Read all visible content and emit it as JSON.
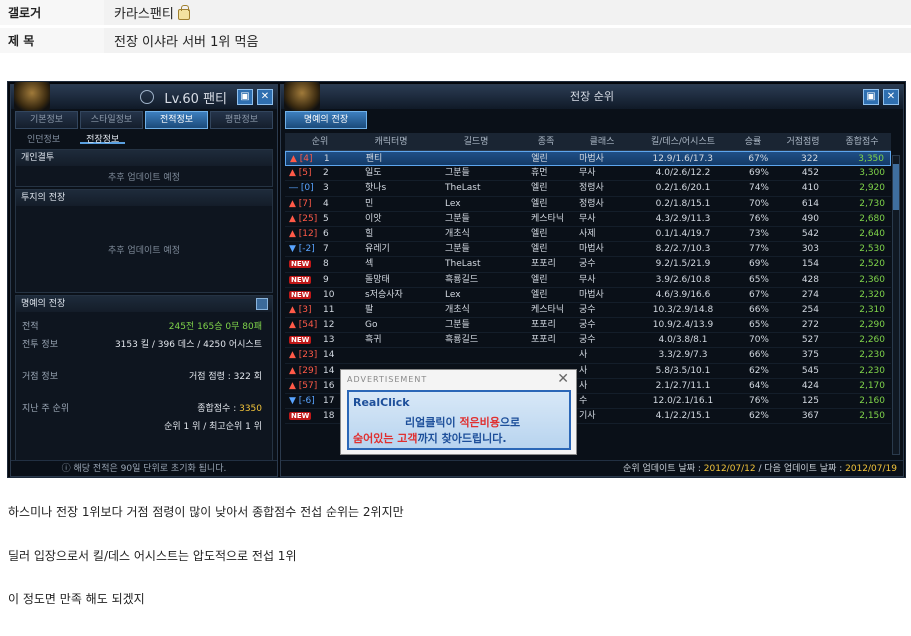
{
  "post": {
    "gallery_label": "갤로거",
    "gallery_value": "카라스팬티",
    "title_label": "제 목",
    "title_value": "전장 이샤라 서버 1위 먹음"
  },
  "left_panel": {
    "level": "Lv.60 팬티",
    "tabs": [
      "기본정보",
      "스타일정보",
      "전적정보",
      "평판정보"
    ],
    "active_tab": 2,
    "subtabs": [
      "인던정보",
      "전장정보"
    ],
    "active_subtab": 1,
    "sec1_title": "개인결투",
    "sec1_body": "추후 업데이트 예정",
    "sec2_title": "투지의 전장",
    "sec2_body": "추후 업데이트 예정",
    "sec3_title": "명예의 전장",
    "stats": [
      {
        "label": "전적",
        "value": "245전 165승 0무 80패"
      },
      {
        "label": "전투 정보",
        "value": "3153 킬 / 396 데스 / 4250 어시스트"
      },
      {
        "label": "거점 정보",
        "value": "거점 점령 : 322 회"
      },
      {
        "label": "지난 주 순위",
        "value_prefix": "종합점수 : ",
        "value_highlight": "3350"
      },
      {
        "label": "",
        "value": "순위 1 위 / 최고순위 1 위"
      }
    ],
    "footer": "해당 전적은 90일 단위로 초기화 됩니다."
  },
  "right_panel": {
    "title": "전장 순위",
    "tab": "명예의 전장",
    "headers": [
      "순위",
      "캐릭터명",
      "길드명",
      "종족",
      "클래스",
      "킬/데스/어시스트",
      "승률",
      "거점점령",
      "종합점수"
    ],
    "rows": [
      {
        "change": "▲ [4]",
        "dir": "up",
        "rank": "1",
        "name": "팬티",
        "guild": "",
        "race": "엘린",
        "cls": "마법사",
        "kda": "12.9/1.6/17.3",
        "win": "67%",
        "base": "322",
        "score": "3,350"
      },
      {
        "change": "▲ [5]",
        "dir": "up",
        "rank": "2",
        "name": "일도",
        "guild": "그분들",
        "race": "휴먼",
        "cls": "무사",
        "kda": "4.0/2.6/12.2",
        "win": "69%",
        "base": "452",
        "score": "3,300"
      },
      {
        "change": "― [0]",
        "dir": "same",
        "rank": "3",
        "name": "핫나s",
        "guild": "TheLast",
        "race": "엘린",
        "cls": "정령사",
        "kda": "0.2/1.6/20.1",
        "win": "74%",
        "base": "410",
        "score": "2,920"
      },
      {
        "change": "▲ [7]",
        "dir": "up",
        "rank": "4",
        "name": "민",
        "guild": "Lex",
        "race": "엘린",
        "cls": "정령사",
        "kda": "0.2/1.8/15.1",
        "win": "70%",
        "base": "614",
        "score": "2,730"
      },
      {
        "change": "▲ [25]",
        "dir": "up",
        "rank": "5",
        "name": "이앗",
        "guild": "그분들",
        "race": "케스타닉",
        "cls": "무사",
        "kda": "4.3/2.9/11.3",
        "win": "76%",
        "base": "490",
        "score": "2,680"
      },
      {
        "change": "▲ [12]",
        "dir": "up",
        "rank": "6",
        "name": "힐",
        "guild": "개초식",
        "race": "엘린",
        "cls": "사제",
        "kda": "0.1/1.4/19.7",
        "win": "73%",
        "base": "542",
        "score": "2,640"
      },
      {
        "change": "▼ [-2]",
        "dir": "dn",
        "rank": "7",
        "name": "유레기",
        "guild": "그분들",
        "race": "엘린",
        "cls": "마법사",
        "kda": "8.2/2.7/10.3",
        "win": "77%",
        "base": "303",
        "score": "2,530"
      },
      {
        "change": "NEW",
        "dir": "new",
        "rank": "8",
        "name": "섹",
        "guild": "TheLast",
        "race": "포포리",
        "cls": "궁수",
        "kda": "9.2/1.5/21.9",
        "win": "69%",
        "base": "154",
        "score": "2,520"
      },
      {
        "change": "NEW",
        "dir": "new",
        "rank": "9",
        "name": "돌망태",
        "guild": "흑룡길드",
        "race": "엘린",
        "cls": "무사",
        "kda": "3.9/2.6/10.8",
        "win": "65%",
        "base": "428",
        "score": "2,360"
      },
      {
        "change": "NEW",
        "dir": "new",
        "rank": "10",
        "name": "s저승사자",
        "guild": "Lex",
        "race": "엘린",
        "cls": "마법사",
        "kda": "4.6/3.9/16.6",
        "win": "67%",
        "base": "274",
        "score": "2,320"
      },
      {
        "change": "▲ [3]",
        "dir": "up",
        "rank": "11",
        "name": "팔",
        "guild": "개초식",
        "race": "케스타닉",
        "cls": "궁수",
        "kda": "10.3/2.9/14.8",
        "win": "66%",
        "base": "254",
        "score": "2,310"
      },
      {
        "change": "▲ [54]",
        "dir": "up",
        "rank": "12",
        "name": "Go",
        "guild": "그분들",
        "race": "포포리",
        "cls": "궁수",
        "kda": "10.9/2.4/13.9",
        "win": "65%",
        "base": "272",
        "score": "2,290"
      },
      {
        "change": "NEW",
        "dir": "new",
        "rank": "13",
        "name": "흑귀",
        "guild": "흑룡길드",
        "race": "포포리",
        "cls": "궁수",
        "kda": "4.0/3.8/8.1",
        "win": "70%",
        "base": "527",
        "score": "2,260"
      },
      {
        "change": "▲ [23]",
        "dir": "up",
        "rank": "14",
        "name": "",
        "guild": "",
        "race": "",
        "cls": "사",
        "kda": "3.3/2.9/7.3",
        "win": "66%",
        "base": "375",
        "score": "2,230"
      },
      {
        "change": "▲ [29]",
        "dir": "up",
        "rank": "14",
        "name": "",
        "guild": "",
        "race": "",
        "cls": "사",
        "kda": "5.8/3.5/10.1",
        "win": "62%",
        "base": "545",
        "score": "2,230"
      },
      {
        "change": "▲ [57]",
        "dir": "up",
        "rank": "16",
        "name": "",
        "guild": "",
        "race": "",
        "cls": "사",
        "kda": "2.1/2.7/11.1",
        "win": "64%",
        "base": "424",
        "score": "2,170"
      },
      {
        "change": "▼ [-6]",
        "dir": "dn",
        "rank": "17",
        "name": "",
        "guild": "",
        "race": "",
        "cls": "수",
        "kda": "12.0/2.1/16.1",
        "win": "76%",
        "base": "125",
        "score": "2,160"
      },
      {
        "change": "NEW",
        "dir": "new",
        "rank": "18",
        "name": "",
        "guild": "",
        "race": "",
        "cls": "기사",
        "kda": "4.1/2.2/15.1",
        "win": "62%",
        "base": "367",
        "score": "2,150"
      }
    ],
    "footer_update_label": "순위 업데이트 날짜 : ",
    "footer_update_date": "2012/07/12",
    "footer_next_label": " / 다음 업데이트 날짜 : ",
    "footer_next_date": "2012/07/19"
  },
  "ad": {
    "header": "ADVERTISEMENT",
    "logo": "RealClick",
    "line1_a": "리얼클릭이 ",
    "line1_b": "적은비용",
    "line1_c": "으로",
    "line2_a": "숨어있는 고객",
    "line2_b": "까지 찾아드립니다."
  },
  "body": [
    "하스미나 전장 1위보다 거점 점령이 많이 낮아서 종합점수 전섭 순위는 2위지만",
    "딜러 입장으로서 킬/데스 어시스트는 압도적으로 전섭 1위",
    "이 정도면 만족 해도 되겠지"
  ]
}
